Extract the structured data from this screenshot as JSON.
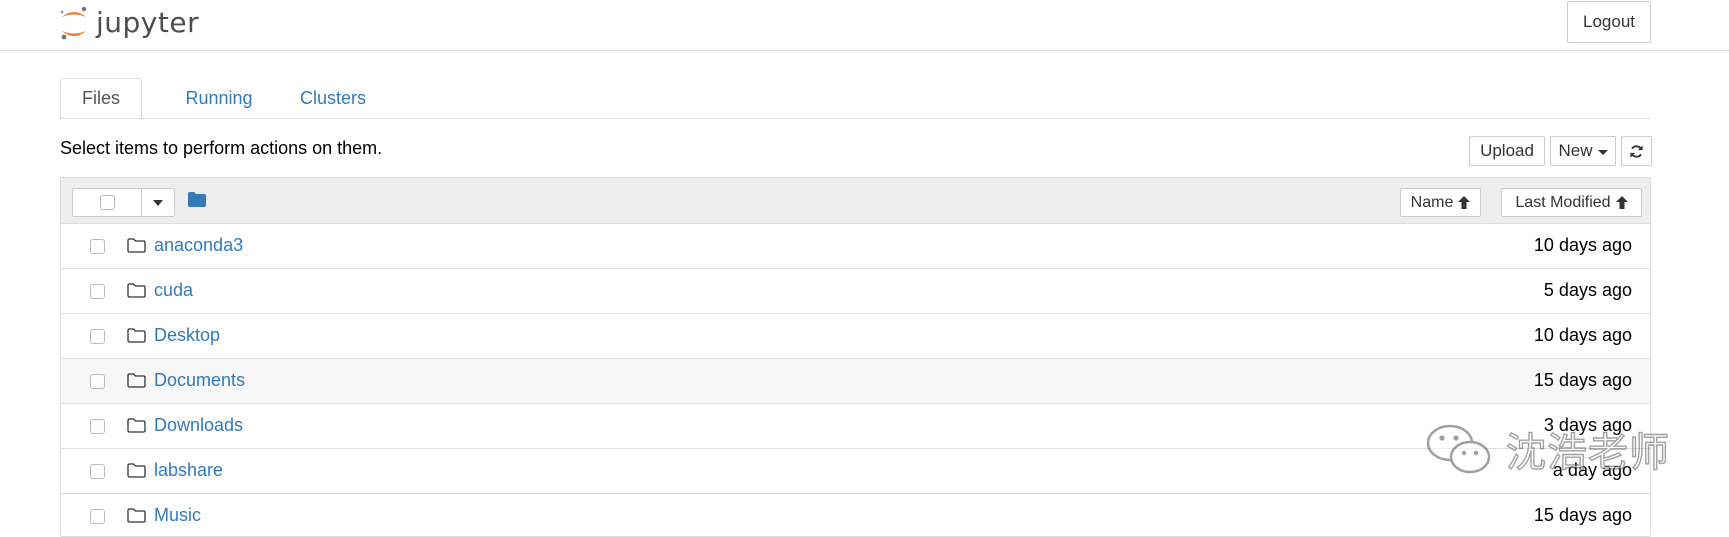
{
  "app": {
    "logo_text": "jupyter"
  },
  "header": {
    "logout_label": "Logout"
  },
  "tabs": [
    {
      "label": "Files",
      "active": true
    },
    {
      "label": "Running",
      "active": false
    },
    {
      "label": "Clusters",
      "active": false
    }
  ],
  "toolbar": {
    "hint": "Select items to perform actions on them.",
    "upload_label": "Upload",
    "new_label": "New",
    "refresh_icon": "refresh-icon"
  },
  "list_header": {
    "sort_name_label": "Name",
    "sort_modified_label": "Last Modified"
  },
  "files": [
    {
      "name": "anaconda3",
      "modified": "10 days ago"
    },
    {
      "name": "cuda",
      "modified": "5 days ago"
    },
    {
      "name": "Desktop",
      "modified": "10 days ago"
    },
    {
      "name": "Documents",
      "modified": "15 days ago"
    },
    {
      "name": "Downloads",
      "modified": "3 days ago"
    },
    {
      "name": "labshare",
      "modified": "a day ago"
    },
    {
      "name": "Music",
      "modified": "15 days ago"
    }
  ],
  "watermark": {
    "text": "沈浩老师"
  },
  "colors": {
    "link": "#337ab7",
    "logo_orange": "#f37726",
    "header_bg": "#eeeeee"
  }
}
